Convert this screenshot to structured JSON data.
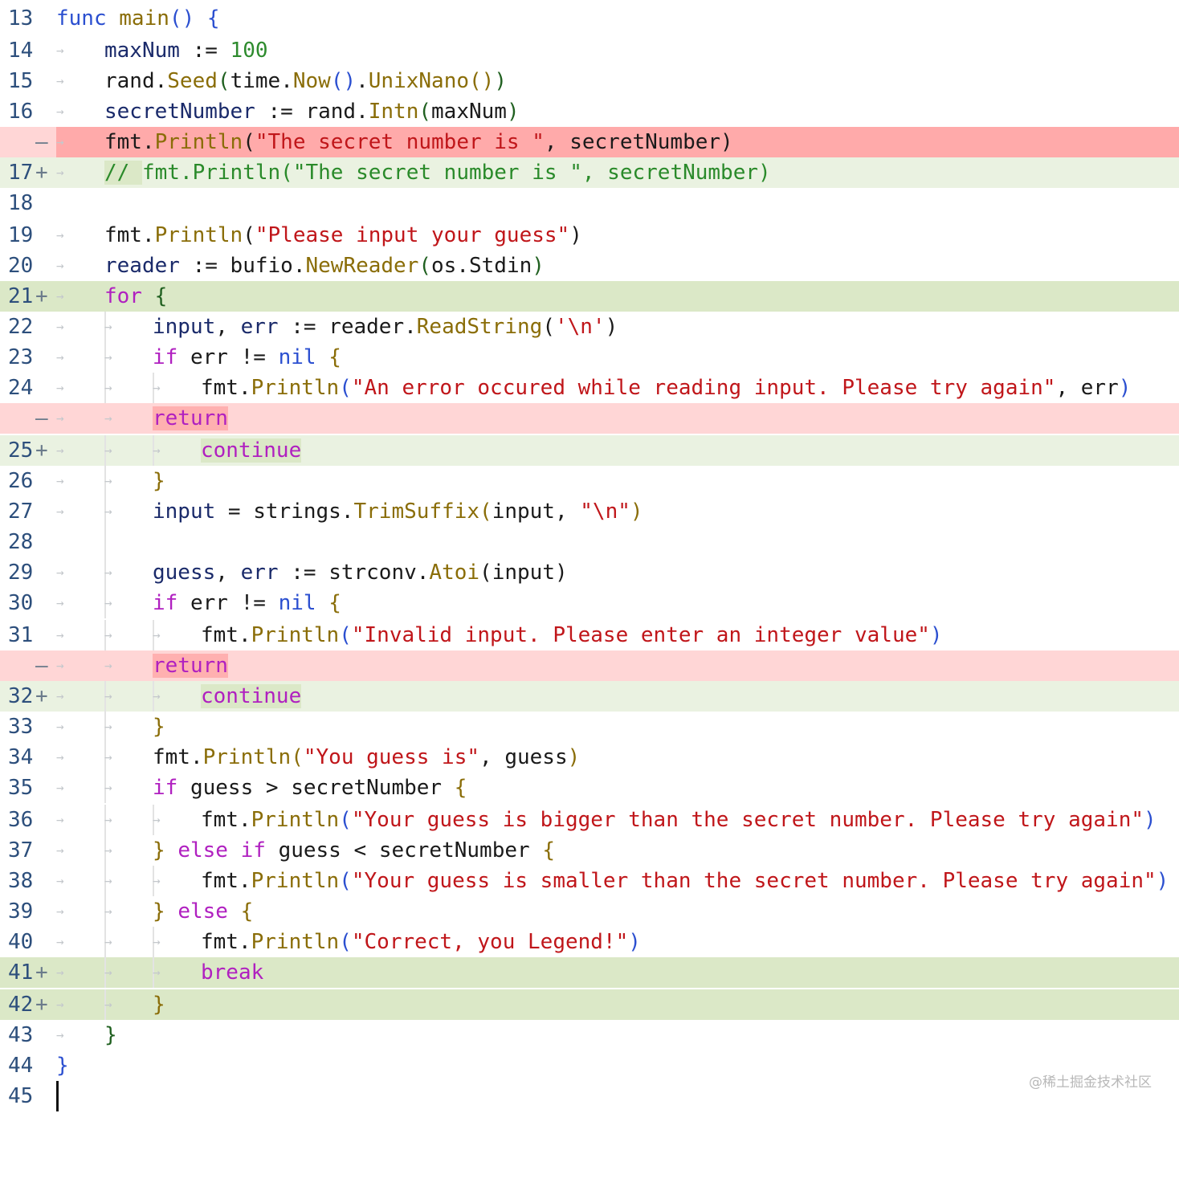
{
  "editor": {
    "lines": [
      {
        "num": "13",
        "mark": ""
      },
      {
        "num": "14",
        "mark": ""
      },
      {
        "num": "15",
        "mark": ""
      },
      {
        "num": "16",
        "mark": ""
      },
      {
        "num": "",
        "mark": "—"
      },
      {
        "num": "17",
        "mark": "+"
      },
      {
        "num": "18",
        "mark": ""
      },
      {
        "num": "19",
        "mark": ""
      },
      {
        "num": "20",
        "mark": ""
      },
      {
        "num": "21",
        "mark": "+"
      },
      {
        "num": "22",
        "mark": ""
      },
      {
        "num": "23",
        "mark": ""
      },
      {
        "num": "24",
        "mark": ""
      },
      {
        "num": "",
        "mark": "—"
      },
      {
        "num": "25",
        "mark": "+"
      },
      {
        "num": "26",
        "mark": ""
      },
      {
        "num": "27",
        "mark": ""
      },
      {
        "num": "28",
        "mark": ""
      },
      {
        "num": "29",
        "mark": ""
      },
      {
        "num": "30",
        "mark": ""
      },
      {
        "num": "31",
        "mark": ""
      },
      {
        "num": "",
        "mark": "—"
      },
      {
        "num": "32",
        "mark": "+"
      },
      {
        "num": "33",
        "mark": ""
      },
      {
        "num": "34",
        "mark": ""
      },
      {
        "num": "35",
        "mark": ""
      },
      {
        "num": "36",
        "mark": ""
      },
      {
        "num": "37",
        "mark": ""
      },
      {
        "num": "38",
        "mark": ""
      },
      {
        "num": "39",
        "mark": ""
      },
      {
        "num": "40",
        "mark": ""
      },
      {
        "num": "41",
        "mark": "+"
      },
      {
        "num": "42",
        "mark": "+"
      },
      {
        "num": "43",
        "mark": ""
      },
      {
        "num": "44",
        "mark": ""
      },
      {
        "num": "45",
        "mark": ""
      }
    ],
    "tok": {
      "func": "func",
      "main": "main",
      "lp": "(",
      "rp": ")",
      "lb": "{",
      "rb": "}",
      "maxNum": "maxNum",
      "assign": " := ",
      "eq": " = ",
      "hundred": "100",
      "rand": "rand",
      "dot": ".",
      "Seed": "Seed",
      "time": "time",
      "Now": "Now",
      "UnixNano": "UnixNano",
      "secretNumber": "secretNumber",
      "Intn": "Intn",
      "fmt": "fmt",
      "Println": "Println",
      "s_secret": "\"The secret number is \"",
      "comma": ", ",
      "comment": "// ",
      "s_guessprompt": "\"Please input your guess\"",
      "reader": "reader",
      "bufio": "bufio",
      "NewReader": "NewReader",
      "osStdin": "os.Stdin",
      "for": "for",
      "input": "input",
      "err": "err",
      "ReadString": "ReadString",
      "s_nl_char": "'\\n'",
      "if": "if",
      "neq": " != ",
      "nil": "nil",
      "s_err": "\"An error occured while reading input. Please try again\"",
      "return": "return",
      "continue": "continue",
      "strings": "strings",
      "TrimSuffix": "TrimSuffix",
      "s_nl": "\"\\n\"",
      "guess": "guess",
      "strconv": "strconv",
      "Atoi": "Atoi",
      "s_invalid": "\"Invalid input. Please enter an integer value\"",
      "s_youguess": "\"You guess is\"",
      "gt": " > ",
      "lt": " < ",
      "s_bigger": "\"Your guess is bigger than the secret number. Please try again\"",
      "else": "else",
      "s_smaller": "\"Your guess is smaller than the secret number. Please try again\"",
      "s_correct": "\"Correct, you Legend!\"",
      "break": "break",
      "sp": " "
    }
  },
  "watermark": "@稀土掘金技术社区",
  "colors": {
    "added_line": "#eaf2e1",
    "added_block": "#dbe8c7",
    "removed_line": "#ffd6d6",
    "removed_strong": "#ffaaaa"
  }
}
